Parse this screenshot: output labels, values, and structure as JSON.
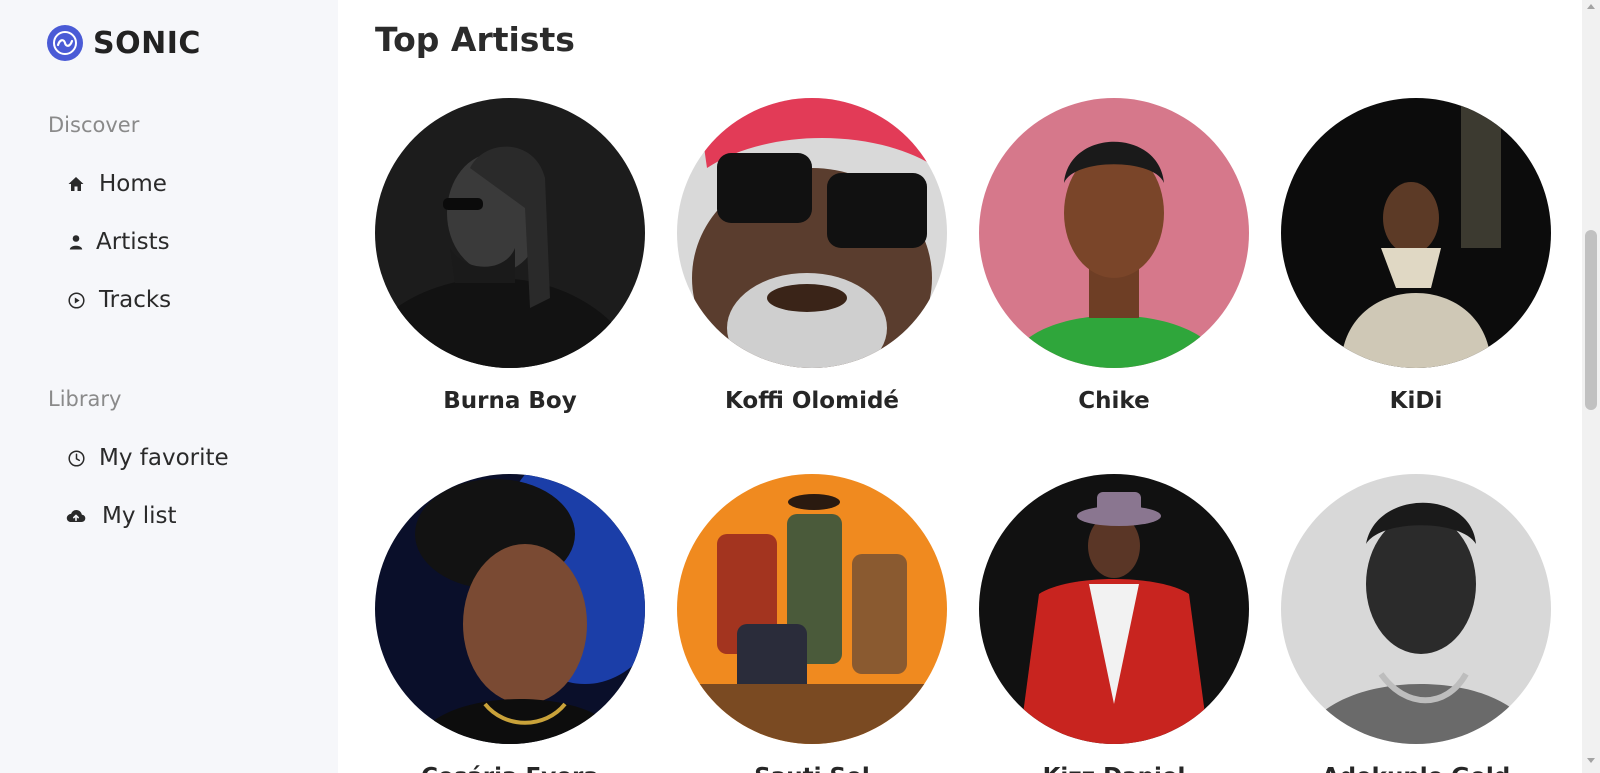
{
  "app": {
    "brand": "SONIC",
    "accent_color": "#4a5bd6",
    "logo_icon": "sonic-swirl-icon"
  },
  "sidebar": {
    "discover_title": "Discover",
    "discover_items": [
      {
        "label": "Home",
        "icon": "home-icon"
      },
      {
        "label": "Artists",
        "icon": "person-icon"
      },
      {
        "label": "Tracks",
        "icon": "play-circle-icon"
      }
    ],
    "library_title": "Library",
    "library_items": [
      {
        "label": "My favorite",
        "icon": "clock-icon"
      },
      {
        "label": "My list",
        "icon": "cloud-upload-icon"
      }
    ]
  },
  "main": {
    "title": "Top Artists",
    "artists": [
      {
        "name": "Burna Boy"
      },
      {
        "name": "Koffi Olomidé"
      },
      {
        "name": "Chike"
      },
      {
        "name": "KiDi"
      },
      {
        "name": "Cesária Evora"
      },
      {
        "name": "Sauti Sol"
      },
      {
        "name": "Kizz Daniel"
      },
      {
        "name": "Adekunle Gold"
      }
    ]
  }
}
